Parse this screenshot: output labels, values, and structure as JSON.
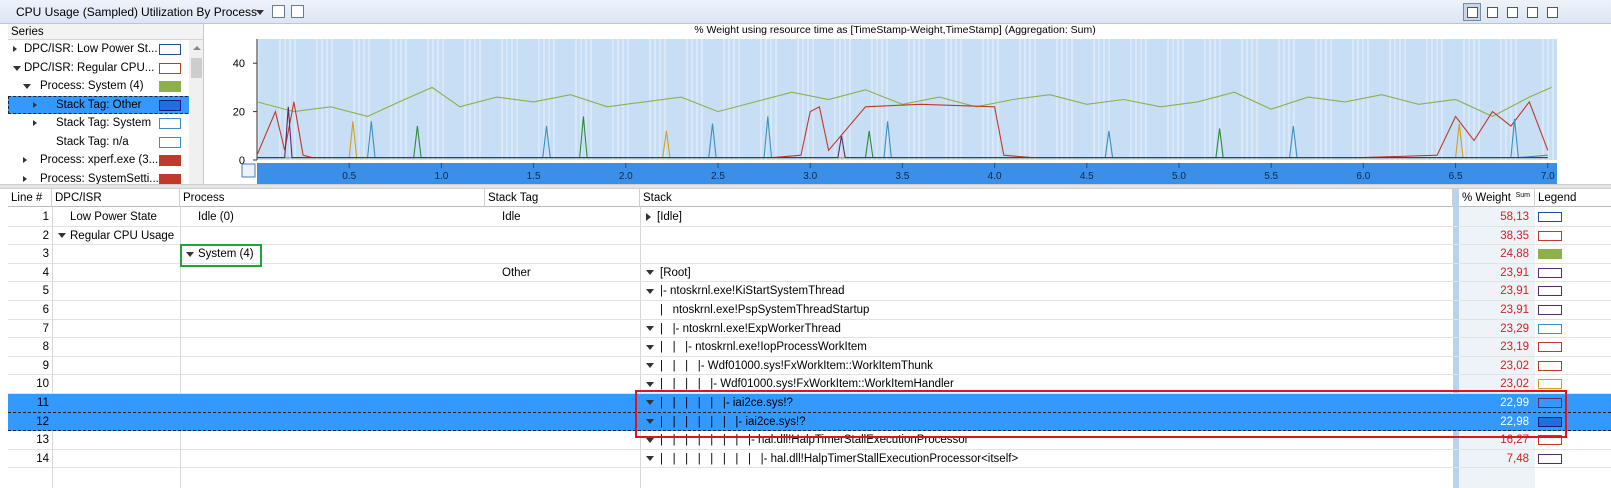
{
  "titlebar": {
    "title": "CPU Usage (Sampled)",
    "view_selector": "Utilization By Process"
  },
  "series": {
    "header": "Series",
    "items": [
      {
        "label": "DPC/ISR: Low Power St...",
        "indent": 0,
        "toggle": "collapsed",
        "color": "#1f4e9c",
        "fill": "#ffffff",
        "selected": false
      },
      {
        "label": "DPC/ISR: Regular CPU...",
        "indent": 0,
        "toggle": "expanded",
        "color": "#c0392b",
        "fill": "#ffffff",
        "selected": false
      },
      {
        "label": "Process: System (4)",
        "indent": 1,
        "toggle": "expanded",
        "color": "#8db04a",
        "fill": "#8db04a",
        "selected": false
      },
      {
        "label": "Stack Tag: Other",
        "indent": 2,
        "toggle": "collapsed",
        "color": "#1a1a7a",
        "fill": "#1e6fe0",
        "selected": true
      },
      {
        "label": "Stack Tag: System",
        "indent": 2,
        "toggle": "collapsed",
        "color": "#3d8fbf",
        "fill": "#ffffff",
        "selected": false
      },
      {
        "label": "Stack Tag: n/a",
        "indent": 2,
        "toggle": "none",
        "color": "#3d8fbf",
        "fill": "#ffffff",
        "selected": false
      },
      {
        "label": "Process: xperf.exe (3...",
        "indent": 1,
        "toggle": "collapsed",
        "color": "#c0392b",
        "fill": "#c0392b",
        "selected": false
      },
      {
        "label": "Process: SystemSetti...",
        "indent": 1,
        "toggle": "collapsed",
        "color": "#c0392b",
        "fill": "#c0392b",
        "selected": false
      }
    ]
  },
  "graph": {
    "title": "% Weight using resource time as [TimeStamp-Weight,TimeStamp] (Aggregation: Sum)"
  },
  "chart_data": {
    "type": "line",
    "xlim": [
      0.0,
      7.05
    ],
    "ylim": [
      0,
      50
    ],
    "x_ticks": [
      "0.5",
      "1.0",
      "1.5",
      "2.0",
      "2.5",
      "3.0",
      "3.5",
      "4.0",
      "4.5",
      "5.0",
      "5.5",
      "6.0",
      "6.5",
      "7.0"
    ],
    "y_ticks": [
      "0",
      "20",
      "40"
    ],
    "series": [
      {
        "color": "#8db04a",
        "x": [
          0.0,
          0.2,
          0.4,
          0.6,
          0.8,
          0.95,
          1.1,
          1.3,
          1.5,
          1.7,
          1.9,
          2.1,
          2.3,
          2.5,
          2.7,
          2.9,
          3.1,
          3.3,
          3.5,
          3.7,
          3.9,
          4.1,
          4.3,
          4.5,
          4.7,
          4.9,
          5.1,
          5.3,
          5.5,
          5.7,
          5.9,
          6.1,
          6.3,
          6.5,
          6.7,
          6.9,
          7.02
        ],
        "y": [
          24,
          20,
          22,
          18,
          25,
          30,
          22,
          26,
          24,
          27,
          22,
          24,
          26,
          20,
          24,
          28,
          25,
          29,
          23,
          26,
          22,
          25,
          27,
          23,
          25,
          22,
          24,
          28,
          21,
          26,
          24,
          27,
          23,
          25,
          18,
          26,
          30
        ]
      },
      {
        "color": "#c0392b",
        "x": [
          0.0,
          0.1,
          0.15,
          0.2,
          0.25,
          0.3,
          0.6,
          1.2,
          2.8,
          2.95,
          3.0,
          3.05,
          3.1,
          3.3,
          3.6,
          4.0,
          4.05,
          4.2,
          5.0,
          6.0,
          6.4,
          6.5,
          6.6,
          6.7,
          6.8,
          6.9,
          7.0
        ],
        "y": [
          2,
          20,
          4,
          24,
          2,
          1,
          1,
          1,
          1,
          2,
          20,
          22,
          4,
          22,
          23,
          22,
          2,
          1,
          1,
          1,
          2,
          18,
          8,
          20,
          14,
          24,
          4
        ]
      },
      {
        "color": "#3d8fbf",
        "x": [
          0.0,
          0.6,
          0.62,
          0.64,
          1.55,
          1.57,
          1.59,
          2.45,
          2.47,
          2.49,
          2.75,
          2.77,
          2.79,
          3.4,
          3.42,
          3.44,
          4.6,
          4.62,
          4.64,
          5.6,
          5.62,
          5.64,
          6.8,
          6.82,
          6.84,
          7.0
        ],
        "y": [
          1,
          1,
          16,
          1,
          1,
          14,
          1,
          1,
          15,
          1,
          1,
          18,
          1,
          1,
          16,
          1,
          1,
          12,
          1,
          1,
          14,
          1,
          1,
          17,
          1,
          2
        ]
      },
      {
        "color": "#2e8b3a",
        "x": [
          0.0,
          0.85,
          0.87,
          0.89,
          1.75,
          1.77,
          1.79,
          3.3,
          3.32,
          3.34,
          5.2,
          5.22,
          5.24,
          7.0
        ],
        "y": [
          1,
          1,
          14,
          1,
          1,
          18,
          1,
          1,
          12,
          1,
          1,
          13,
          1,
          1
        ]
      },
      {
        "color": "#d4a020",
        "x": [
          0.0,
          0.5,
          0.52,
          0.54,
          2.2,
          2.22,
          2.24,
          6.5,
          6.52,
          6.54,
          7.0
        ],
        "y": [
          1,
          1,
          16,
          1,
          1,
          12,
          1,
          1,
          15,
          1,
          1
        ]
      },
      {
        "color": "#5b2a6e",
        "x": [
          0.0,
          0.15,
          0.17,
          0.19,
          3.15,
          3.17,
          3.19,
          7.0
        ],
        "y": [
          1,
          1,
          22,
          1,
          1,
          10,
          1,
          1
        ]
      }
    ]
  },
  "table": {
    "columns": [
      "Line #",
      "DPC/ISR",
      "Process",
      "Stack Tag",
      "Stack",
      "% Weight",
      "Sum",
      "Legend"
    ],
    "rows": [
      {
        "line": "1",
        "dpc": "Low Power State",
        "dpc_toggle": "none",
        "process": "Idle (0)",
        "process_toggle": "none",
        "tag": "Idle",
        "stack": "[Idle]",
        "stack_prefix": "",
        "stack_toggle": "collapsed",
        "weight": "58,13",
        "legend_color": "#1f4e9c",
        "legend_fill": "#ffffff",
        "selected": false
      },
      {
        "line": "2",
        "dpc": "Regular CPU Usage",
        "dpc_toggle": "expanded",
        "process": "",
        "process_toggle": "none",
        "tag": "",
        "stack": "",
        "stack_prefix": "",
        "stack_toggle": "none",
        "weight": "38,35",
        "legend_color": "#c0392b",
        "legend_fill": "#ffffff",
        "selected": false
      },
      {
        "line": "3",
        "dpc": "",
        "dpc_toggle": "none",
        "process": "System (4)",
        "process_toggle": "expanded",
        "tag": "",
        "stack": "",
        "stack_prefix": "",
        "stack_toggle": "none",
        "weight": "24,88",
        "legend_color": "#8db04a",
        "legend_fill": "#8db04a",
        "selected": false
      },
      {
        "line": "4",
        "dpc": "",
        "dpc_toggle": "none",
        "process": "",
        "process_toggle": "none",
        "tag": "Other",
        "stack": "[Root]",
        "stack_prefix": "",
        "stack_toggle": "expanded",
        "weight": "23,91",
        "legend_color": "#5b2a6e",
        "legend_fill": "#ffffff",
        "selected": false
      },
      {
        "line": "5",
        "dpc": "",
        "dpc_toggle": "none",
        "process": "",
        "process_toggle": "none",
        "tag": "",
        "stack": "ntoskrnl.exe!KiStartSystemThread",
        "stack_prefix": "|- ",
        "stack_toggle": "expanded",
        "weight": "23,91",
        "legend_color": "#5b2a6e",
        "legend_fill": "#ffffff",
        "selected": false
      },
      {
        "line": "6",
        "dpc": "",
        "dpc_toggle": "none",
        "process": "",
        "process_toggle": "none",
        "tag": "",
        "stack": "ntoskrnl.exe!PspSystemThreadStartup",
        "stack_prefix": "|   ",
        "stack_toggle": "none",
        "weight": "23,91",
        "legend_color": "#5b2a6e",
        "legend_fill": "#ffffff",
        "selected": false
      },
      {
        "line": "7",
        "dpc": "",
        "dpc_toggle": "none",
        "process": "",
        "process_toggle": "none",
        "tag": "",
        "stack": "ntoskrnl.exe!ExpWorkerThread",
        "stack_prefix": "|   |- ",
        "stack_toggle": "expanded",
        "weight": "23,29",
        "legend_color": "#3d8fbf",
        "legend_fill": "#ffffff",
        "selected": false
      },
      {
        "line": "8",
        "dpc": "",
        "dpc_toggle": "none",
        "process": "",
        "process_toggle": "none",
        "tag": "",
        "stack": "ntoskrnl.exe!IopProcessWorkItem",
        "stack_prefix": "|   |   |- ",
        "stack_toggle": "expanded",
        "weight": "23,19",
        "legend_color": "#c0392b",
        "legend_fill": "#ffffff",
        "selected": false
      },
      {
        "line": "9",
        "dpc": "",
        "dpc_toggle": "none",
        "process": "",
        "process_toggle": "none",
        "tag": "",
        "stack": "Wdf01000.sys!FxWorkItem::WorkItemThunk",
        "stack_prefix": "|   |   |   |- ",
        "stack_toggle": "expanded",
        "weight": "23,02",
        "legend_color": "#c0392b",
        "legend_fill": "#ffffff",
        "selected": false
      },
      {
        "line": "10",
        "dpc": "",
        "dpc_toggle": "none",
        "process": "",
        "process_toggle": "none",
        "tag": "",
        "stack": "Wdf01000.sys!FxWorkItem::WorkItemHandler",
        "stack_prefix": "|   |   |   |   |- ",
        "stack_toggle": "expanded",
        "weight": "23,02",
        "legend_color": "#d4a020",
        "legend_fill": "#ffffff",
        "selected": false
      },
      {
        "line": "11",
        "dpc": "",
        "dpc_toggle": "none",
        "process": "",
        "process_toggle": "none",
        "tag": "",
        "stack": "iai2ce.sys!?",
        "stack_prefix": "|   |   |   |   |   |- ",
        "stack_toggle": "expanded",
        "weight": "22,99",
        "legend_color": "#5b2a6e",
        "legend_fill": "#3399ff",
        "selected": true
      },
      {
        "line": "12",
        "dpc": "",
        "dpc_toggle": "none",
        "process": "",
        "process_toggle": "none",
        "tag": "",
        "stack": "iai2ce.sys!?",
        "stack_prefix": "|   |   |   |   |   |   |- ",
        "stack_toggle": "expanded",
        "weight": "22,98",
        "legend_color": "#1a1a7a",
        "legend_fill": "#1e6fe0",
        "selected": true
      },
      {
        "line": "13",
        "dpc": "",
        "dpc_toggle": "none",
        "process": "",
        "process_toggle": "none",
        "tag": "",
        "stack": "hal.dll!HalpTimerStallExecutionProcessor",
        "stack_prefix": "|   |   |   |   |   |   |   |- ",
        "stack_toggle": "expanded",
        "weight": "16,27",
        "legend_color": "#c0392b",
        "legend_fill": "#ffffff",
        "selected": false
      },
      {
        "line": "14",
        "dpc": "",
        "dpc_toggle": "none",
        "process": "",
        "process_toggle": "none",
        "tag": "",
        "stack": "hal.dll!HalpTimerStallExecutionProcessor<itself>",
        "stack_prefix": "|   |   |   |   |   |   |   |   |- ",
        "stack_toggle": "expanded",
        "weight": "7,48",
        "legend_color": "#5b2a6e",
        "legend_fill": "#ffffff",
        "selected": false
      }
    ]
  }
}
